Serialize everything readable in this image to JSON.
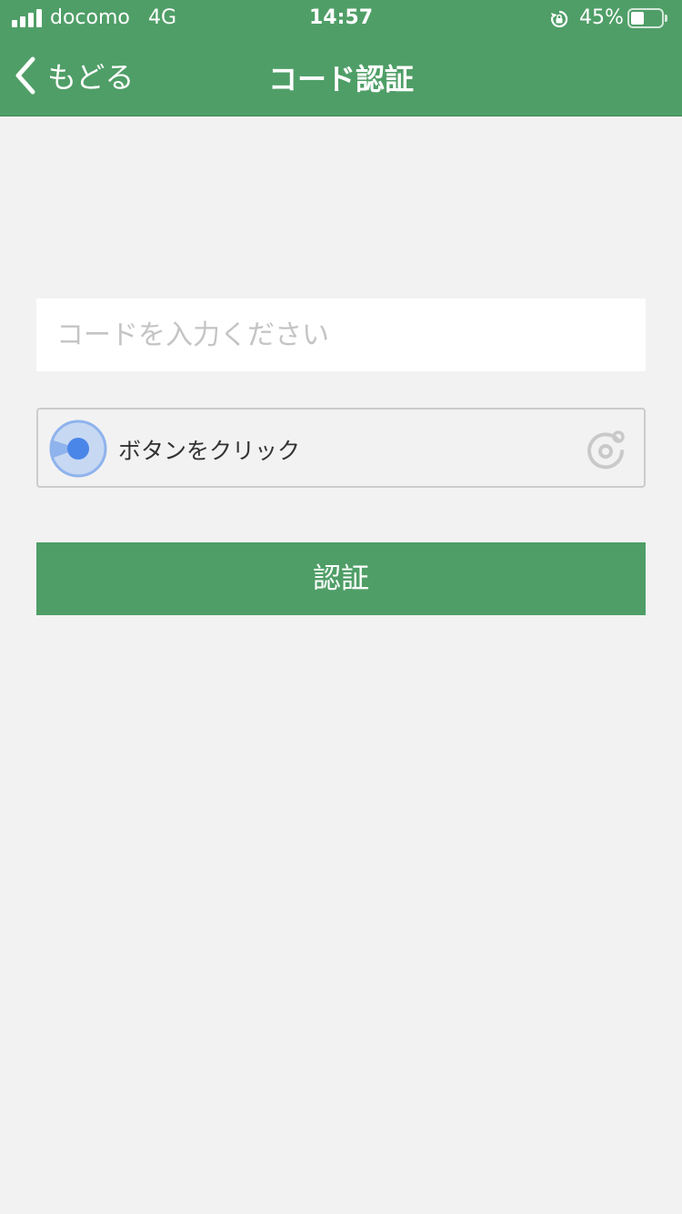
{
  "status_bar": {
    "carrier": "docomo",
    "network": "4G",
    "time": "14:57",
    "battery_percent_label": "45%",
    "battery_level": 0.45,
    "signal_bars": 4,
    "icons": [
      "signal-icon",
      "rotation-lock-icon",
      "battery-icon"
    ]
  },
  "nav": {
    "back_label": "もどる",
    "title": "コード認証",
    "back_icon": "chevron-left-icon"
  },
  "form": {
    "code_input": {
      "placeholder": "コードを入力ください",
      "value": ""
    },
    "captcha": {
      "label": "ボタンをクリック",
      "knob_icon": "captcha-knob-icon",
      "logo_icon": "captcha-logo-icon"
    },
    "submit_label": "認証"
  },
  "colors": {
    "brand_green": "#4f9e67",
    "background": "#f2f2f2",
    "captcha_blue": "#4a86e8",
    "captcha_blue_light": "#c7d8f3"
  }
}
